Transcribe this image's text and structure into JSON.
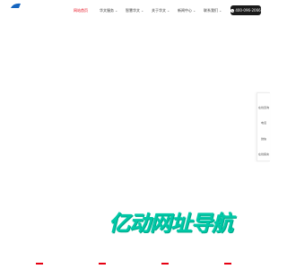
{
  "nav": {
    "items": [
      {
        "label": "网站首页",
        "active": true,
        "dropdown": false
      },
      {
        "label": "华文服务",
        "active": false,
        "dropdown": true
      },
      {
        "label": "智慧华文",
        "active": false,
        "dropdown": true
      },
      {
        "label": "关于华文",
        "active": false,
        "dropdown": true
      },
      {
        "label": "新闻中心",
        "active": false,
        "dropdown": true
      },
      {
        "label": "联系我们",
        "active": false,
        "dropdown": true
      }
    ],
    "phone": "400-096-2066"
  },
  "side_panel": {
    "items": [
      "在线咨询",
      "电话",
      "微信",
      "在线留言"
    ]
  },
  "watermark": {
    "text": "亿动网址导航"
  },
  "colors": {
    "accent": "#e60012",
    "brand": "#1565c0",
    "watermark": "#00c9a7",
    "phone_bg": "#1a1a1a"
  }
}
